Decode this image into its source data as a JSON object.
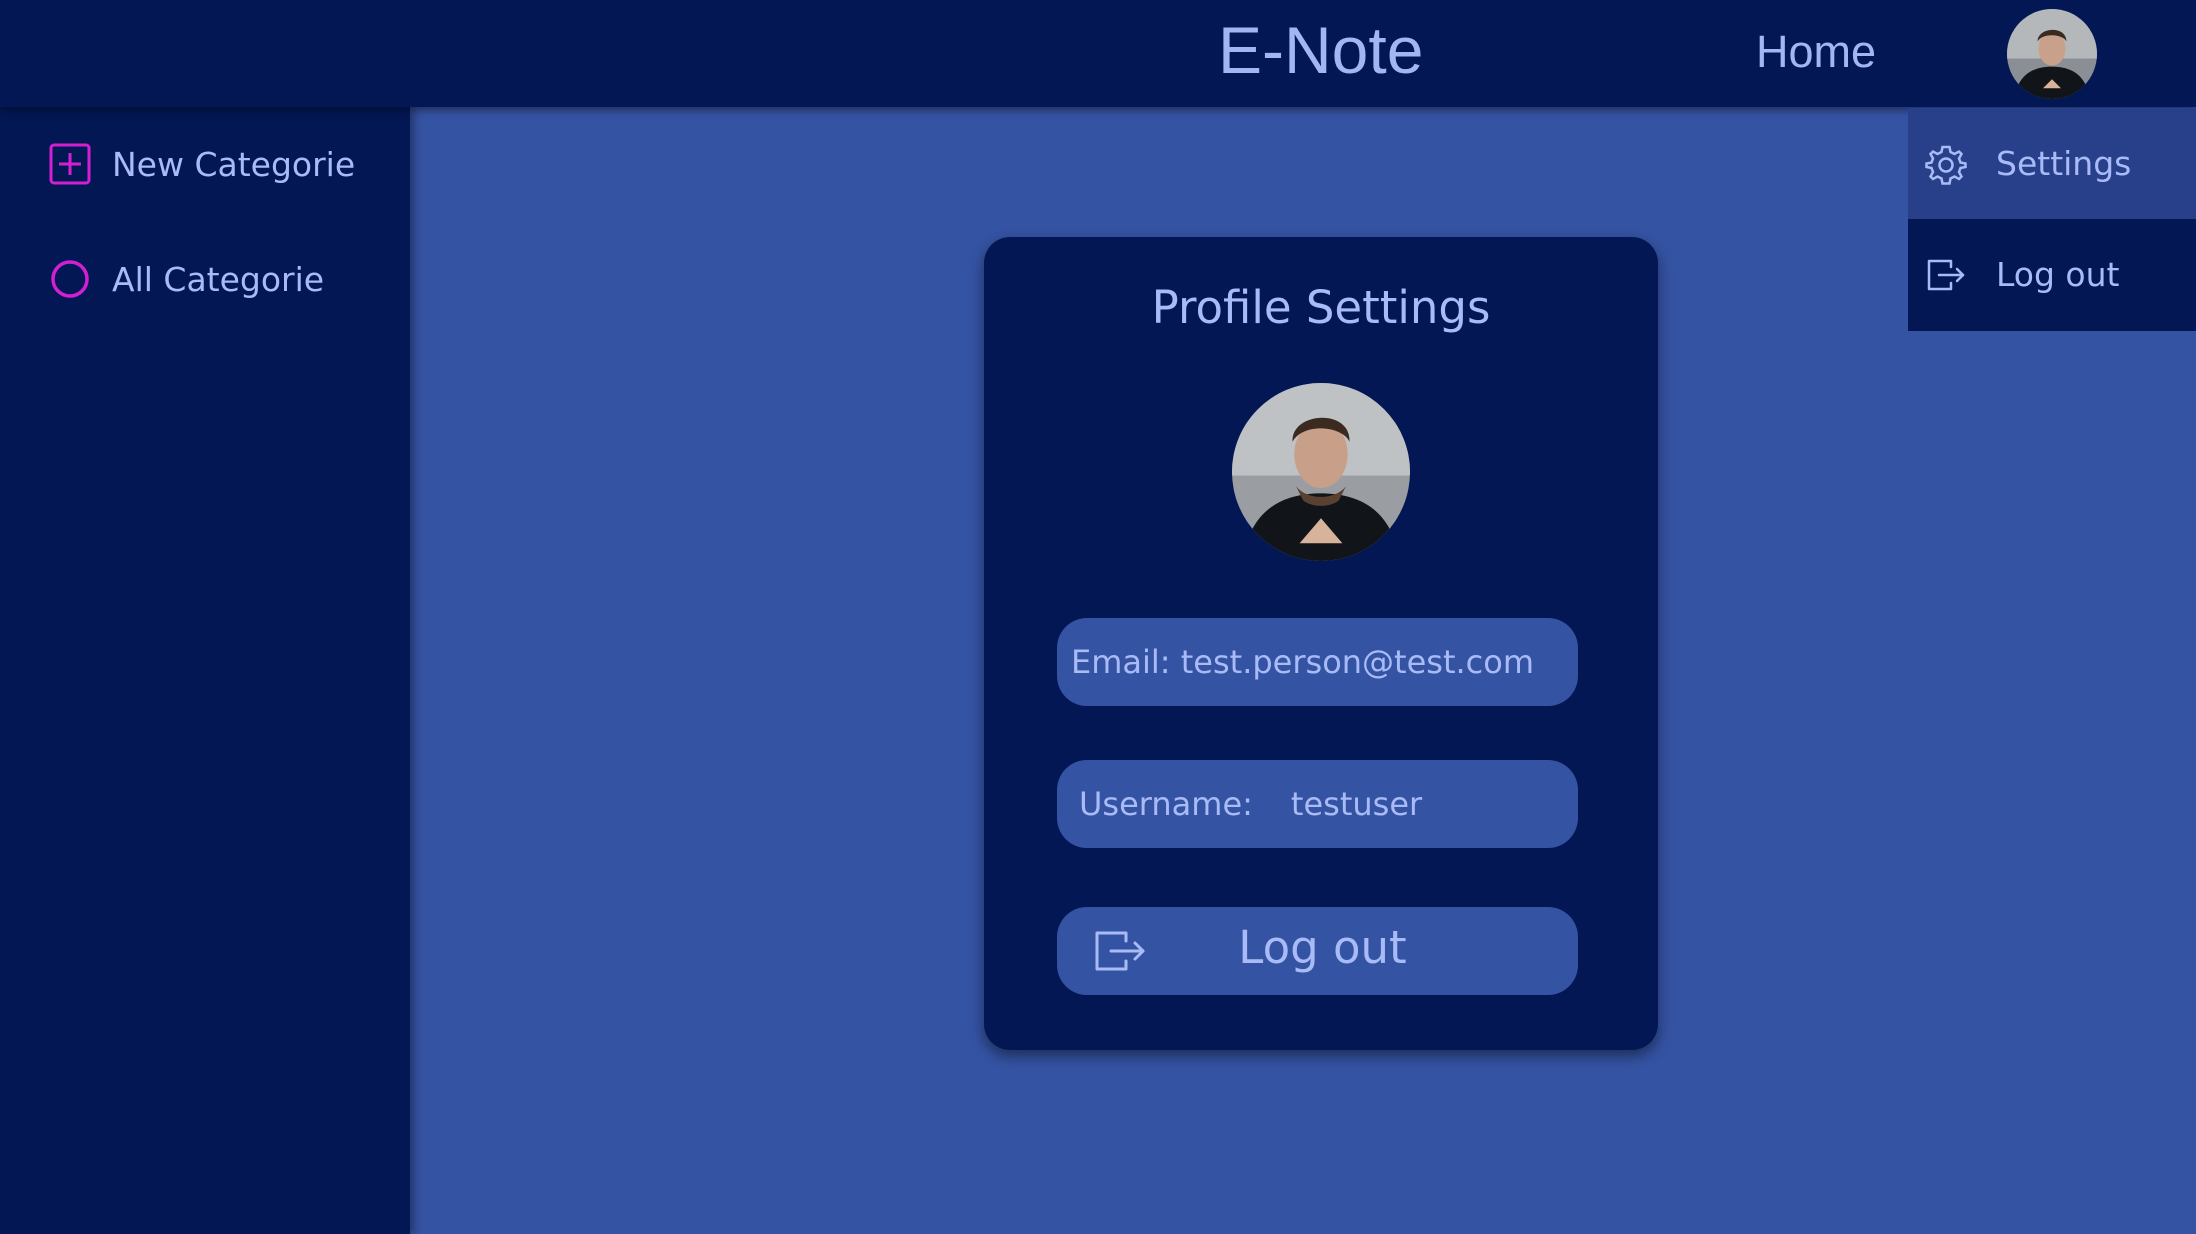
{
  "header": {
    "title": "E-Note",
    "home_label": "Home",
    "avatar_icon": "user-avatar"
  },
  "sidebar": {
    "items": [
      {
        "label": "New Categorie",
        "icon": "plus-square-icon",
        "color": "#d21fd2"
      },
      {
        "label": "All Categorie",
        "icon": "circle-icon",
        "color": "#d21fd2"
      }
    ]
  },
  "dropdown": {
    "items": [
      {
        "label": "Settings",
        "icon": "gear-icon",
        "active": true
      },
      {
        "label": "Log out",
        "icon": "logout-icon"
      }
    ]
  },
  "profile": {
    "title": "Profile Settings",
    "email_text": "Email: test.person@test.com",
    "username_label": "Username:",
    "username_value": "testuser",
    "logout_label": "Log out"
  },
  "colors": {
    "background": "#3553a3",
    "panel": "#041755",
    "text": "#a9bbf7",
    "accent": "#d21fd2"
  }
}
